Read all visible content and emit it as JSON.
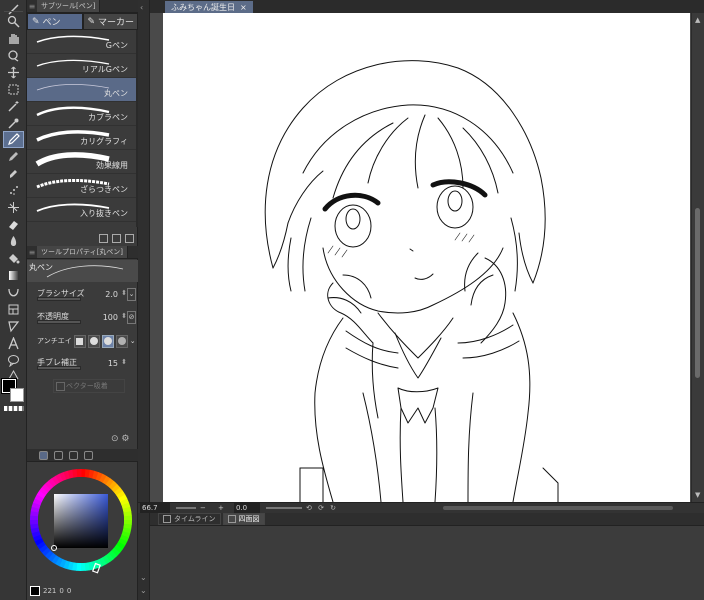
{
  "panels": {
    "subtool_title": "サブツール[ペン]",
    "subtabs": [
      {
        "label": "ペン",
        "icon": "pen-icon",
        "selected": true
      },
      {
        "label": "マーカー",
        "icon": "marker-icon",
        "selected": false
      }
    ],
    "brushes": [
      {
        "label": "Gペン",
        "selected": false
      },
      {
        "label": "リアルGペン",
        "selected": false
      },
      {
        "label": "丸ペン",
        "selected": true
      },
      {
        "label": "カブラペン",
        "selected": false
      },
      {
        "label": "カリグラフィ",
        "selected": false
      },
      {
        "label": "効果線用",
        "selected": false
      },
      {
        "label": "ざらつきペン",
        "selected": false
      },
      {
        "label": "入り抜きペン",
        "selected": false
      }
    ],
    "toolprop_title": "ツールプロパティ[丸ペン]",
    "current_brush": "丸ペン",
    "properties": {
      "brush_size_label": "ブラシサイズ",
      "brush_size": "2.0",
      "opacity_label": "不透明度",
      "opacity": "100",
      "antialias_label": "アンチエイ",
      "stabilization_label": "手ブレ補正",
      "stabilization": "15",
      "vector_label": "ベクター吸着"
    },
    "color_footer_value": "221",
    "color_footer_zero1": "0",
    "color_footer_zero2": "0"
  },
  "document": {
    "tab_title": "ふみちゃん誕生日",
    "close_glyph": "×"
  },
  "statusbar": {
    "zoom": "66.7",
    "angle": "0.0"
  },
  "timeline": {
    "tabs": [
      {
        "label": "タイムライン",
        "selected": false
      },
      {
        "label": "四面図",
        "selected": true
      }
    ]
  },
  "colors": {
    "accent": "#5c6f90",
    "panel_bg": "#3b3b3b",
    "canvas_bg": "#ffffff"
  },
  "icons": {
    "toolbar": [
      "zoom-icon",
      "hand-icon",
      "rotate-icon",
      "move-icon",
      "select-rect-icon",
      "magic-wand-icon",
      "eyedropper-icon",
      "pen-icon",
      "pencil-icon",
      "marker-icon",
      "airbrush-icon",
      "decoration-icon",
      "eraser-icon",
      "blend-icon",
      "fill-icon",
      "gradient-icon",
      "shape-icon",
      "frame-icon",
      "ruler-icon",
      "text-icon",
      "balloon-icon",
      "correct-line-icon"
    ]
  }
}
